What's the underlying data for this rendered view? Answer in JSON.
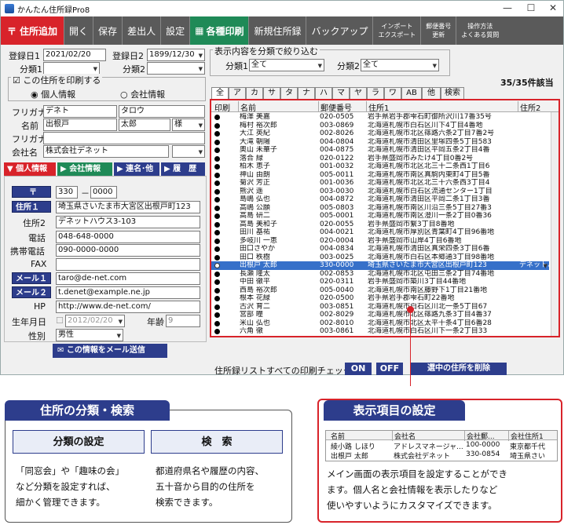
{
  "app": {
    "title": "かんたん住所録Pro8"
  },
  "window": {
    "minimize": "—",
    "maximize": "☐",
    "close": "✕"
  },
  "toolbar": {
    "add": "住所追加",
    "open": "開く",
    "save": "保存",
    "sender": "差出人",
    "settings": "設定",
    "print": "各種印刷",
    "new_book": "新規住所録",
    "backup": "バックアップ",
    "import1": "インポート",
    "import2": "エクスポート",
    "zip1": "郵便番号",
    "zip2": "更新",
    "help1": "操作方法",
    "help2": "よくある質問"
  },
  "form": {
    "reg1_label": "登録日1",
    "reg1_value": "2021/02/20",
    "reg2_label": "登録日2",
    "reg2_value": "1899/12/30",
    "cat1_label": "分類1",
    "cat2_label": "分類2",
    "print_check": "この住所を印刷する",
    "radio_personal": "個人情報",
    "radio_company": "会社情報",
    "kana_label": "フリガナ",
    "kana_last": "デネト",
    "kana_first": "タロウ",
    "name_label": "名前",
    "name_last": "出根戸",
    "name_first": "太郎",
    "honorific": "様",
    "kana2_label": "フリガナ",
    "company_label": "会社名",
    "company_value": "株式会社デネット",
    "tab_personal": "個人情報",
    "tab_company": "会社情報",
    "tab_joint": "連名･他",
    "tab_history": "履　歴",
    "zip_btn": "〒",
    "zip1": "330",
    "zip_dash": "－",
    "zip2": "0000",
    "addr1_btn": "住所１",
    "addr1": "埼玉県さいたま市大宮区出根戸町123",
    "addr2_label": "住所2",
    "addr2": "デネットハウス3-103",
    "tel_label": "電話",
    "tel": "048-648-0000",
    "mobile_label": "携帯電話",
    "mobile": "090-0000-0000",
    "fax_label": "FAX",
    "fax": "",
    "mail1_btn": "メール１",
    "mail1": "taro@de-net.com",
    "mail2_btn": "メール２",
    "mail2": "t.denet@example.ne.jp",
    "hp_label": "HP",
    "hp": "http://www.de-net.com/",
    "birth_label": "生年月日",
    "birth": "2012/02/20",
    "age_label": "年齢",
    "age": "9",
    "sex_label": "性別",
    "sex": "男性",
    "send_mail": "この情報をメール送信"
  },
  "filter": {
    "group_label": "表示内容を分類で絞り込む",
    "cat1_label": "分類1",
    "cat1": "全て",
    "cat2_label": "分類2",
    "cat2": "全て",
    "count": "35/35件該当"
  },
  "kana_tabs": [
    "全",
    "ア",
    "カ",
    "サ",
    "タ",
    "ナ",
    "ハ",
    "マ",
    "ヤ",
    "ラ",
    "ワ",
    "AB",
    "他",
    "検索"
  ],
  "list": {
    "headers": [
      "印刷",
      "名前",
      "郵便番号",
      "住所1",
      "住所2"
    ],
    "rows": [
      [
        "梅澤 美嘉",
        "020-0505",
        "岩手県岩手郡雫石町御所沢川17番35号",
        ""
      ],
      [
        "梅村 裕次郎",
        "003-0869",
        "北海道札幌市白石区川下4丁目4番地",
        ""
      ],
      [
        "大江 英紀",
        "002-8026",
        "北海道札幌市北区篠路六条2丁目7番2号",
        ""
      ],
      [
        "大滝 朝陽",
        "004-0804",
        "北海道札幌市清田区里塚四条5丁目583",
        ""
      ],
      [
        "奥山 未華子",
        "004-0875",
        "北海道札幌市清田区平岡五条2丁目4番",
        ""
      ],
      [
        "落合 緑",
        "020-0122",
        "岩手県盛岡市みたけ4丁目0番2号",
        ""
      ],
      [
        "柏木 恵子",
        "001-0032",
        "北海道札幌市北区北三十二条西1丁目6",
        ""
      ],
      [
        "神山 由朗",
        "005-0011",
        "北海道札幌市南区真駒内東町4丁目5番",
        ""
      ],
      [
        "菊沢 芳正",
        "001-0036",
        "北海道札幌市北区北三十六条西3丁目4",
        ""
      ],
      [
        "熊沢 遥",
        "003-0030",
        "北海道札幌市白石区流通センター1丁目",
        ""
      ],
      [
        "島嶋 弘也",
        "004-0872",
        "北海道札幌市清田区平岡二条1丁目3番",
        ""
      ],
      [
        "高嶋 公願",
        "005-0803",
        "北海道札幌市南区川沿三条5丁目27番3",
        ""
      ],
      [
        "高島 研二",
        "005-0001",
        "北海道札幌市南区澄川一条2丁目0番36",
        ""
      ],
      [
        "高島 美和子",
        "020-0055",
        "岩手県盛岡市繋3丁目8番地",
        ""
      ],
      [
        "田川 基祐",
        "004-0021",
        "北海道札幌市厚別区青葉町4丁目96番地",
        ""
      ],
      [
        "多岐川 一恵",
        "020-0004",
        "岩手県盛岡市山岸4丁目6番地",
        ""
      ],
      [
        "田口さやか",
        "004-0834",
        "北海道札幌市清田区真栄四条3丁目6番",
        ""
      ],
      [
        "田口 秩樹",
        "003-0025",
        "北海道札幌市白石区本郷通3丁目98番地",
        ""
      ],
      [
        "出根戸 太郎",
        "330-0000",
        "埼玉県さいたま市大宮区出根戸町123",
        "デネットハ"
      ],
      [
        "長瀬 隆太",
        "002-0853",
        "北海道札幌市北区屯田三条2丁目74番地",
        ""
      ],
      [
        "中田 徹平",
        "020-0311",
        "岩手県盛岡市築川3丁目44番地",
        ""
      ],
      [
        "西島 裕次郎",
        "005-0040",
        "北海道札幌市南区藤野下1丁目21番地",
        ""
      ],
      [
        "根本 花緑",
        "020-0500",
        "岩手県岩手郡雫石町22番地",
        ""
      ],
      [
        "古沢 育二",
        "003-0851",
        "北海道札幌市白石区川北一条5丁目67",
        ""
      ],
      [
        "宮部 瞳",
        "002-8029",
        "北海道札幌市北区篠路九条3丁目4番37",
        ""
      ],
      [
        "米山 弘也",
        "002-8010",
        "北海道札幌市北区太平十条4丁目6番28",
        ""
      ],
      [
        "六角 徹",
        "003-0861",
        "北海道札幌市白石区川下一条2丁目33",
        ""
      ]
    ]
  },
  "bottom": {
    "check_label": "住所録リストすべての印刷チェック:",
    "on": "ON",
    "off": "OFF",
    "delete": "選中の住所を削除"
  },
  "callout_left": {
    "title": "住所の分類・検索",
    "box1": "分類の設定",
    "box2": "検　索",
    "text1": [
      "「同窓会」や「趣味の会」",
      "など分類を設定すれば、",
      "細かく管理できます。"
    ],
    "text2": [
      "都道府県名や履歴の内容、",
      "五十音から目的の住所を",
      "検索できます。"
    ]
  },
  "callout_right": {
    "title": "表示項目の設定",
    "mini_headers": [
      "名前",
      "会社名",
      "会社郵...",
      "会社住所1"
    ],
    "mini_rows": [
      [
        "綾小路 しほり",
        "アドレスマネージャ...",
        "100-0000",
        "東京都千代"
      ],
      [
        "出根戸 太郎",
        "株式会社デネット",
        "330-0854",
        "埼玉県さい"
      ]
    ],
    "text": [
      "メイン画面の表示項目を設定することができ",
      "ます。個人名と会社情報を表示したりなど",
      "使いやすいようにカスタマイズできます。"
    ]
  }
}
